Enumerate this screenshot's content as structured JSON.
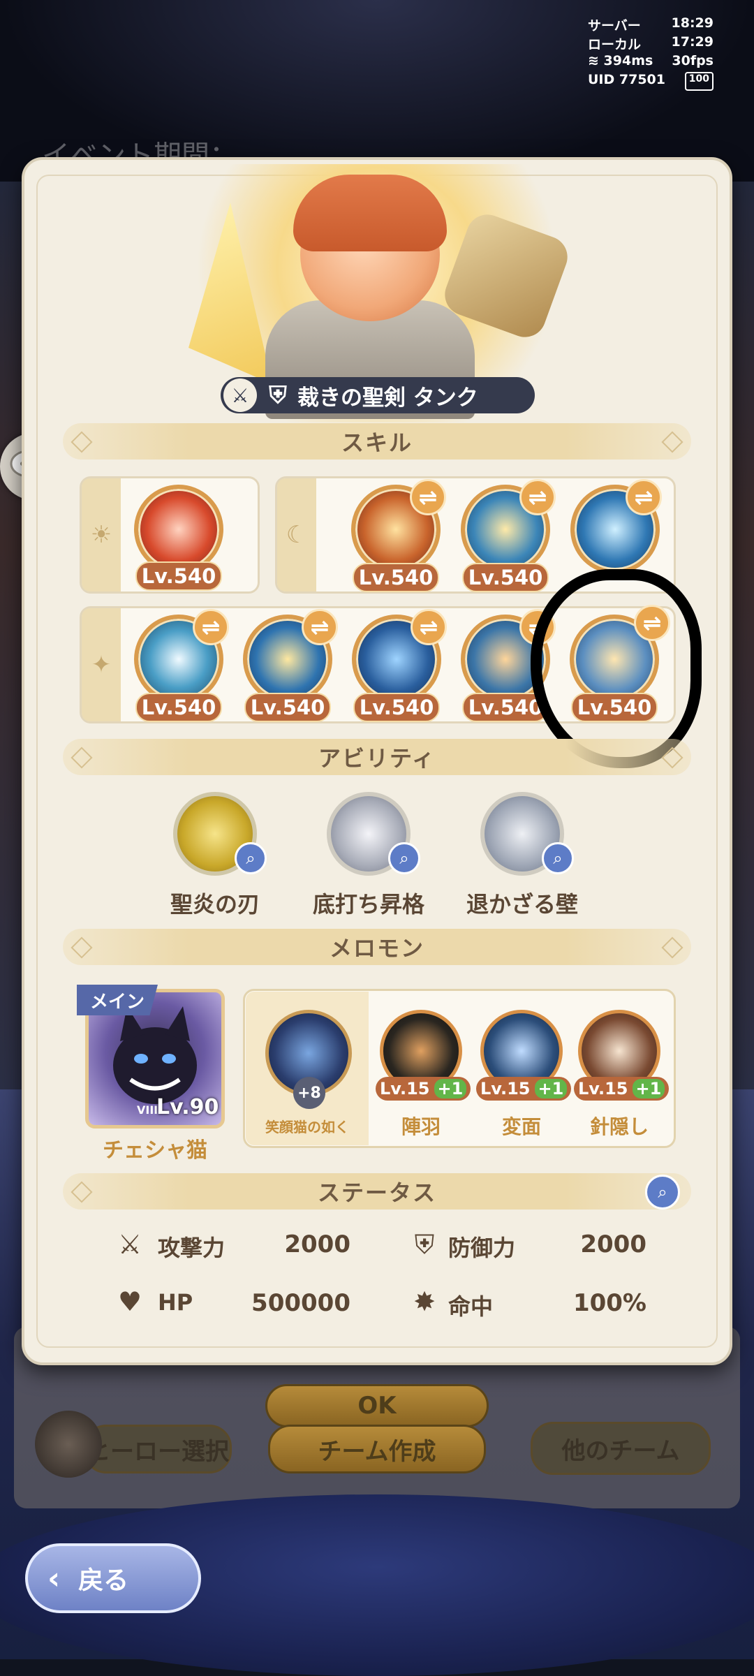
{
  "status_bar": {
    "server_label": "サーバー",
    "server_time": "18:29",
    "local_label": "ローカル",
    "local_time": "17:29",
    "ping": "394ms",
    "fps": "30fps",
    "uid": "UID 77501",
    "battery": "100"
  },
  "background": {
    "event_text": "イベント期間：",
    "hero_select": "ヒーロー選択",
    "team_create": "チーム作成",
    "other_team": "他のチーム",
    "ok_button": "OK"
  },
  "hero": {
    "badge_text": "裁きの聖剣 タンク"
  },
  "sections": {
    "skill": "スキル",
    "ability": "アビリティ",
    "melomon": "メロモン",
    "status": "ステータス"
  },
  "skills": {
    "sun_row": [
      {
        "level": "Lv.540",
        "icon": "butterfly-wing-icon"
      }
    ],
    "moon_row": [
      {
        "level": "Lv.540",
        "icon": "flaming-sword-icon"
      },
      {
        "level": "Lv.540",
        "icon": "golden-fist-icon"
      },
      {
        "level": "Lv.540",
        "icon": "crowned-shield-icon"
      }
    ],
    "star_row": [
      {
        "level": "Lv.540",
        "icon": "light-blade-icon"
      },
      {
        "level": "Lv.540",
        "icon": "blue-flame-icon"
      },
      {
        "level": "Lv.540",
        "icon": "silhouette-icon"
      },
      {
        "level": "Lv.540",
        "icon": "charging-hero-icon"
      },
      {
        "level": "Lv.540",
        "icon": "grabbing-hand-icon"
      }
    ],
    "swap_glyph": "⇌"
  },
  "abilities": [
    {
      "name": "聖炎の刃",
      "icon": "golden-crest-icon",
      "color": "#d8c04a"
    },
    {
      "name": "底打ち昇格",
      "icon": "white-flower-icon",
      "color": "#a8acb8"
    },
    {
      "name": "退かざる壁",
      "icon": "silver-shield-icon",
      "color": "#9ea6b5"
    }
  ],
  "melomon": {
    "main_tag": "メイン",
    "main": {
      "name": "チェシャ猫",
      "level": "Lv.90",
      "rank": "VIII"
    },
    "set_name": "笑顔猫の如く",
    "set_bonus": "+8",
    "subs": [
      {
        "name": "陣羽",
        "level": "Lv.15",
        "plus": "+1",
        "color": "#2a2620"
      },
      {
        "name": "変面",
        "level": "Lv.15",
        "plus": "+1",
        "color": "#2c4e7a"
      },
      {
        "name": "針隠し",
        "level": "Lv.15",
        "plus": "+1",
        "color": "#7a4a32"
      }
    ]
  },
  "stats": {
    "attack_label": "攻撃力",
    "attack_value": "2000",
    "defense_label": "防御力",
    "defense_value": "2000",
    "hp_label": "HP",
    "hp_value": "500000",
    "accuracy_label": "命中",
    "accuracy_value": "100%"
  },
  "back_button": "戻る"
}
